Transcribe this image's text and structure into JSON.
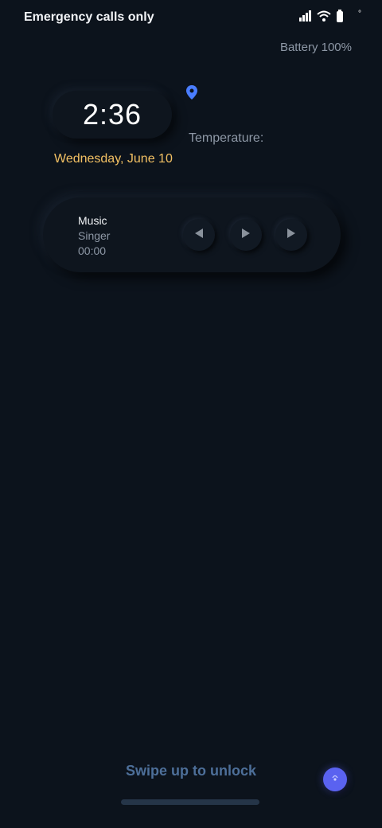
{
  "status_bar": {
    "carrier": "Emergency calls only",
    "icons": [
      "signal-icon",
      "wifi-icon",
      "battery-icon",
      "dot-icon"
    ],
    "dot": "°"
  },
  "battery": {
    "label": "Battery 100%"
  },
  "clock": {
    "time": "2:36",
    "date": "Wednesday, June 10"
  },
  "weather": {
    "temperature_label": "Temperature:",
    "icon": "location-pin-icon"
  },
  "music": {
    "title": "Music",
    "singer": "Singer",
    "elapsed": "00:00",
    "controls": [
      "previous-icon",
      "play-icon",
      "next-icon"
    ]
  },
  "lock": {
    "swipe_hint": "Swipe up to unlock"
  },
  "colors": {
    "background": "#0c131c",
    "date": "#f2c063",
    "accent": "#5a62f0",
    "pin": "#4a7dff",
    "hint": "#4d6f99"
  }
}
